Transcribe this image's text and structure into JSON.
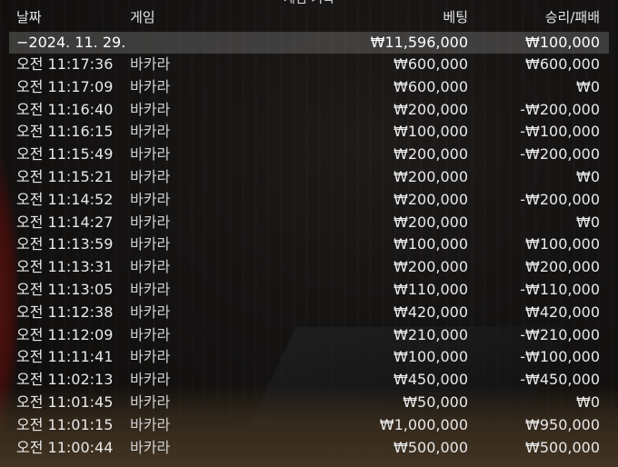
{
  "window": {
    "title": "게임 기록"
  },
  "columns": {
    "date": "날짜",
    "game": "게임",
    "bet": "베팅",
    "win_loss": "승리/패배"
  },
  "day_group": {
    "date": "−2024. 11. 29.",
    "bet_total": "₩11,596,000",
    "win_total": "₩100,000"
  },
  "rows": [
    {
      "time": "오전 11:17:36",
      "game": "바카라",
      "bet": "₩600,000",
      "result": "₩600,000"
    },
    {
      "time": "오전 11:17:09",
      "game": "바카라",
      "bet": "₩600,000",
      "result": "₩0"
    },
    {
      "time": "오전 11:16:40",
      "game": "바카라",
      "bet": "₩200,000",
      "result": "-₩200,000"
    },
    {
      "time": "오전 11:16:15",
      "game": "바카라",
      "bet": "₩100,000",
      "result": "-₩100,000"
    },
    {
      "time": "오전 11:15:49",
      "game": "바카라",
      "bet": "₩200,000",
      "result": "-₩200,000"
    },
    {
      "time": "오전 11:15:21",
      "game": "바카라",
      "bet": "₩200,000",
      "result": "₩0"
    },
    {
      "time": "오전 11:14:52",
      "game": "바카라",
      "bet": "₩200,000",
      "result": "-₩200,000"
    },
    {
      "time": "오전 11:14:27",
      "game": "바카라",
      "bet": "₩200,000",
      "result": "₩0"
    },
    {
      "time": "오전 11:13:59",
      "game": "바카라",
      "bet": "₩100,000",
      "result": "₩100,000"
    },
    {
      "time": "오전 11:13:31",
      "game": "바카라",
      "bet": "₩200,000",
      "result": "₩200,000"
    },
    {
      "time": "오전 11:13:05",
      "game": "바카라",
      "bet": "₩110,000",
      "result": "-₩110,000"
    },
    {
      "time": "오전 11:12:38",
      "game": "바카라",
      "bet": "₩420,000",
      "result": "₩420,000"
    },
    {
      "time": "오전 11:12:09",
      "game": "바카라",
      "bet": "₩210,000",
      "result": "-₩210,000"
    },
    {
      "time": "오전 11:11:41",
      "game": "바카라",
      "bet": "₩100,000",
      "result": "-₩100,000"
    },
    {
      "time": "오전 11:02:13",
      "game": "바카라",
      "bet": "₩450,000",
      "result": "-₩450,000"
    },
    {
      "time": "오전 11:01:45",
      "game": "바카라",
      "bet": "₩50,000",
      "result": "₩0"
    },
    {
      "time": "오전 11:01:15",
      "game": "바카라",
      "bet": "₩1,000,000",
      "result": "₩950,000"
    },
    {
      "time": "오전 11:00:44",
      "game": "바카라",
      "bet": "₩500,000",
      "result": "₩500,000"
    }
  ]
}
